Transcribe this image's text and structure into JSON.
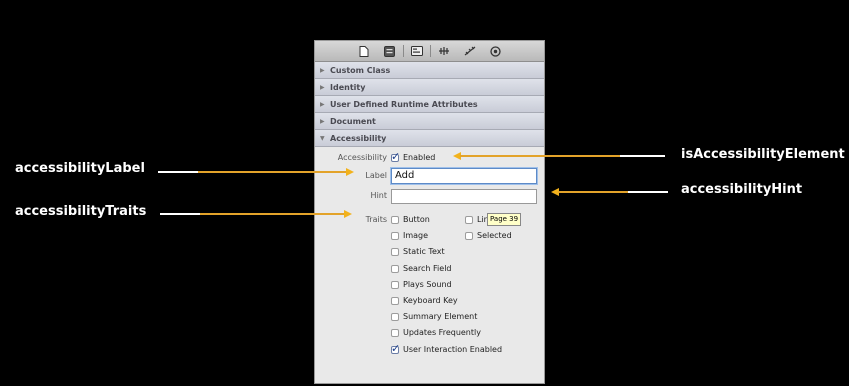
{
  "callouts": {
    "left_label": "accessibilityLabel",
    "left_traits": "accessibilityTraits",
    "right_element": "isAccessibilityElement",
    "right_hint": "accessibilityHint"
  },
  "toolbar": {
    "icons": [
      "file-inspector-icon",
      "quick-help-icon",
      "identity-inspector-icon",
      "attributes-inspector-icon",
      "size-inspector-icon",
      "connections-inspector-icon"
    ]
  },
  "sections": [
    {
      "label": "Custom Class",
      "expanded": false
    },
    {
      "label": "Identity",
      "expanded": false
    },
    {
      "label": "User Defined Runtime Attributes",
      "expanded": false
    },
    {
      "label": "Document",
      "expanded": false
    },
    {
      "label": "Accessibility",
      "expanded": true
    }
  ],
  "accessibility": {
    "accessibility_label": "Accessibility",
    "enabled_label": "Enabled",
    "enabled_checked": true,
    "label_label": "Label",
    "label_value": "Add",
    "hint_label": "Hint",
    "hint_value": "",
    "traits_label": "Traits",
    "tooltip": "Page 39",
    "traits_col1": [
      {
        "label": "Button",
        "checked": false
      },
      {
        "label": "Image",
        "checked": false
      },
      {
        "label": "Static Text",
        "checked": false
      },
      {
        "label": "Search Field",
        "checked": false
      },
      {
        "label": "Plays Sound",
        "checked": false
      },
      {
        "label": "Keyboard Key",
        "checked": false
      },
      {
        "label": "Summary Element",
        "checked": false
      },
      {
        "label": "Updates Frequently",
        "checked": false
      },
      {
        "label": "User Interaction Enabled",
        "checked": true
      }
    ],
    "traits_col2": [
      {
        "label": "Link",
        "checked": false
      },
      {
        "label": "Selected",
        "checked": false
      }
    ]
  }
}
